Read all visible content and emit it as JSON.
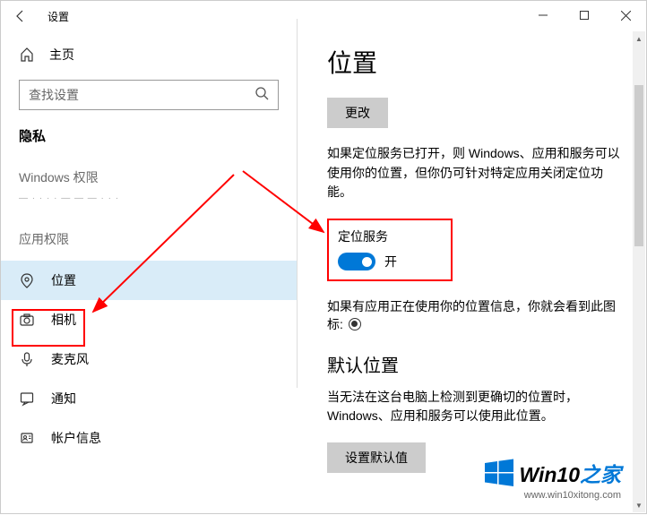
{
  "window": {
    "title": "设置"
  },
  "sidebar": {
    "home": "主页",
    "search_placeholder": "查找设置",
    "section": "隐私",
    "group1": "Windows 权限",
    "group2": "应用权限",
    "items": [
      {
        "label": "位置",
        "icon": "location"
      },
      {
        "label": "相机",
        "icon": "camera"
      },
      {
        "label": "麦克风",
        "icon": "microphone"
      },
      {
        "label": "通知",
        "icon": "notification"
      },
      {
        "label": "帐户信息",
        "icon": "account"
      }
    ]
  },
  "main": {
    "title": "位置",
    "change_btn": "更改",
    "desc1": "如果定位服务已打开，则 Windows、应用和服务可以使用你的位置，但你仍可针对特定应用关闭定位功能。",
    "service_label": "定位服务",
    "toggle_state": "开",
    "desc2_a": "如果有应用正在使用你的位置信息，你就会看到此图",
    "desc2_b": "标: ",
    "section2": "默认位置",
    "desc3": "当无法在这台电脑上检测到更确切的位置时，Windows、应用和服务可以使用此位置。",
    "default_btn": "设置默认值"
  },
  "watermark": {
    "brand_a": "Win10",
    "brand_b": "之家",
    "url": "www.win10xitong.com"
  }
}
